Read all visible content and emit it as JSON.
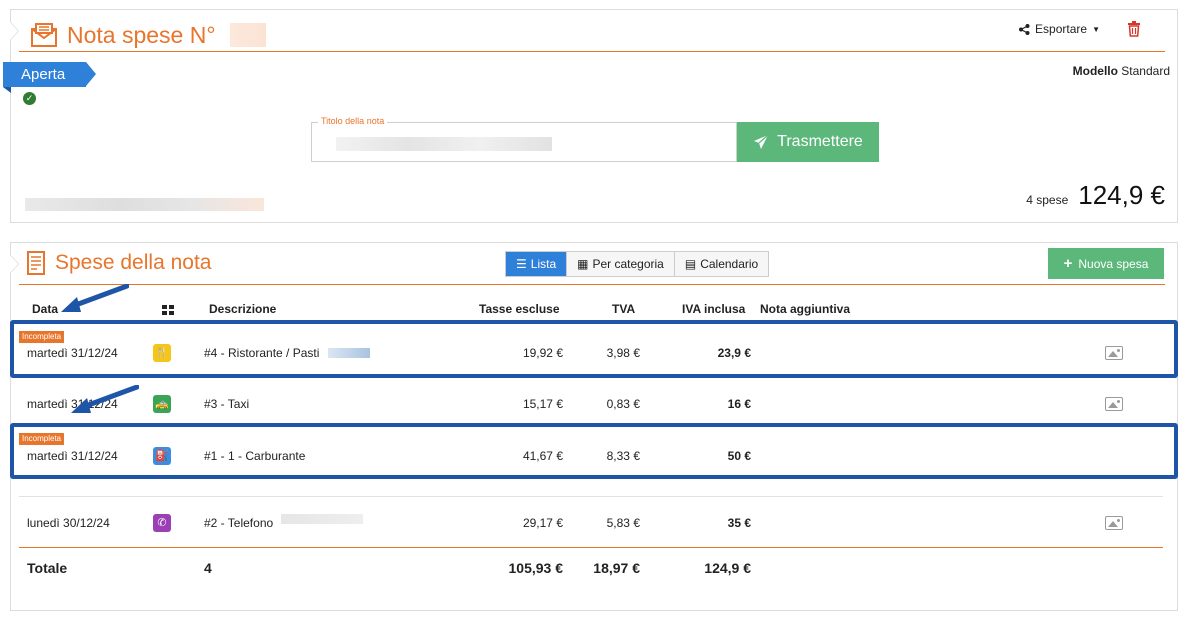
{
  "header": {
    "title": "Nota spese N°",
    "export_label": "Esportare",
    "status": "Aperta",
    "model_label": "Modello",
    "model_value": "Standard",
    "note_title_label": "Titolo della nota",
    "send_label": "Trasmettere",
    "expense_count": "4 spese",
    "total": "124,9 €"
  },
  "list": {
    "title": "Spese della nota",
    "views": [
      "Lista",
      "Per categoria",
      "Calendario"
    ],
    "new_label": "Nuova spesa",
    "columns": {
      "date": "Data",
      "description": "Descrizione",
      "tax_excl": "Tasse escluse",
      "vat": "TVA",
      "vat_incl": "IVA inclusa",
      "note": "Nota aggiuntiva"
    },
    "incomplete_label": "Incompleta",
    "rows": [
      {
        "date": "martedì 31/12/24",
        "desc": "#4 - Ristorante / Pasti",
        "excl": "19,92 €",
        "vat": "3,98 €",
        "incl": "23,9 €"
      },
      {
        "date": "martedì 31/12/24",
        "desc": "#3 - Taxi",
        "excl": "15,17 €",
        "vat": "0,83 €",
        "incl": "16 €"
      },
      {
        "date": "martedì 31/12/24",
        "desc": "#1 - 1 - Carburante",
        "excl": "41,67 €",
        "vat": "8,33 €",
        "incl": "50 €"
      },
      {
        "date": "lunedì 30/12/24",
        "desc": "#2 - Telefono",
        "excl": "29,17 €",
        "vat": "5,83 €",
        "incl": "35 €"
      }
    ],
    "totals": {
      "label": "Totale",
      "count": "4",
      "excl": "105,93 €",
      "vat": "18,97 €",
      "incl": "124,9 €"
    }
  },
  "colors": {
    "accent": "#e8752c",
    "primary": "#2f80d8",
    "success": "#5cb87a",
    "highlight": "#1f55a8"
  },
  "icons": {
    "restaurant": "fork-knife-icon",
    "taxi": "car-icon",
    "fuel": "fuel-icon",
    "phone": "phone-icon"
  }
}
